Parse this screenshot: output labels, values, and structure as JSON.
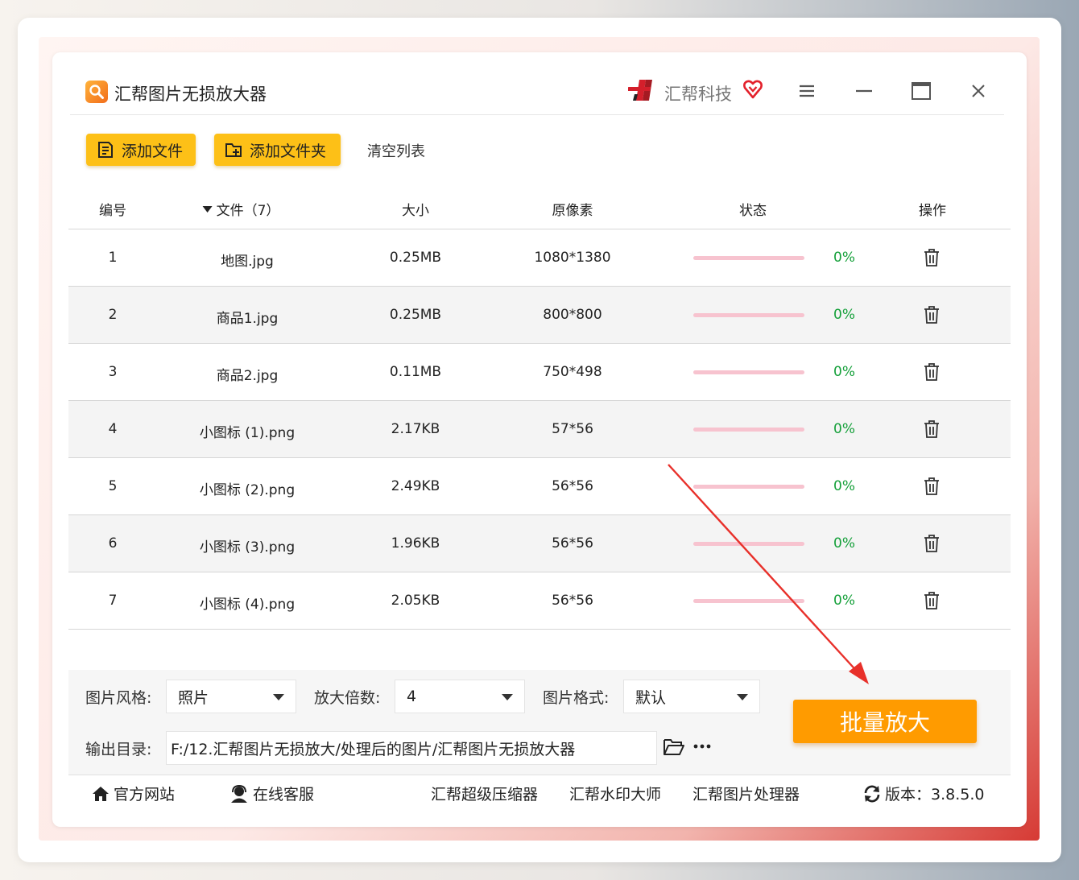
{
  "app": {
    "title": "汇帮图片无损放大器",
    "brand": "汇帮科技",
    "icons": [
      "search-logo-icon",
      "brand-logo-icon",
      "vip-heart-icon",
      "menu-icon",
      "minimize-icon",
      "maximize-icon",
      "close-icon"
    ]
  },
  "toolbar": {
    "add_file": "添加文件",
    "add_folder": "添加文件夹",
    "clear_list": "清空列表"
  },
  "table": {
    "headers": {
      "index": "编号",
      "file": "文件（7）",
      "size": "大小",
      "pixels": "原像素",
      "status": "状态",
      "action": "操作"
    },
    "rows": [
      {
        "index": "1",
        "file": "地图.jpg",
        "size": "0.25MB",
        "pixels": "1080*1380",
        "progress": "0%"
      },
      {
        "index": "2",
        "file": "商品1.jpg",
        "size": "0.25MB",
        "pixels": "800*800",
        "progress": "0%"
      },
      {
        "index": "3",
        "file": "商品2.jpg",
        "size": "0.11MB",
        "pixels": "750*498",
        "progress": "0%"
      },
      {
        "index": "4",
        "file": "小图标 (1).png",
        "size": "2.17KB",
        "pixels": "57*56",
        "progress": "0%"
      },
      {
        "index": "5",
        "file": "小图标 (2).png",
        "size": "2.49KB",
        "pixels": "56*56",
        "progress": "0%"
      },
      {
        "index": "6",
        "file": "小图标 (3).png",
        "size": "1.96KB",
        "pixels": "56*56",
        "progress": "0%"
      },
      {
        "index": "7",
        "file": "小图标 (4).png",
        "size": "2.05KB",
        "pixels": "56*56",
        "progress": "0%"
      }
    ]
  },
  "settings": {
    "style_label": "图片风格:",
    "style_value": "照片",
    "scale_label": "放大倍数:",
    "scale_value": "4",
    "format_label": "图片格式:",
    "format_value": "默认",
    "output_label": "输出目录:",
    "output_path": "F:/12.汇帮图片无损放大/处理后的图片/汇帮图片无损放大器",
    "more_label": "···",
    "batch_button": "批量放大"
  },
  "footer": {
    "website": "官方网站",
    "support": "在线客服",
    "compressor": "汇帮超级压缩器",
    "watermark": "汇帮水印大师",
    "processor": "汇帮图片处理器",
    "version": "版本：3.8.5.0"
  },
  "colors": {
    "accent_yellow": "#fdc017",
    "batch_orange": "#ff9b00",
    "progress_pink": "#f7c3cf",
    "percent_green": "#15a03a",
    "annotation_red": "#e8302a"
  }
}
